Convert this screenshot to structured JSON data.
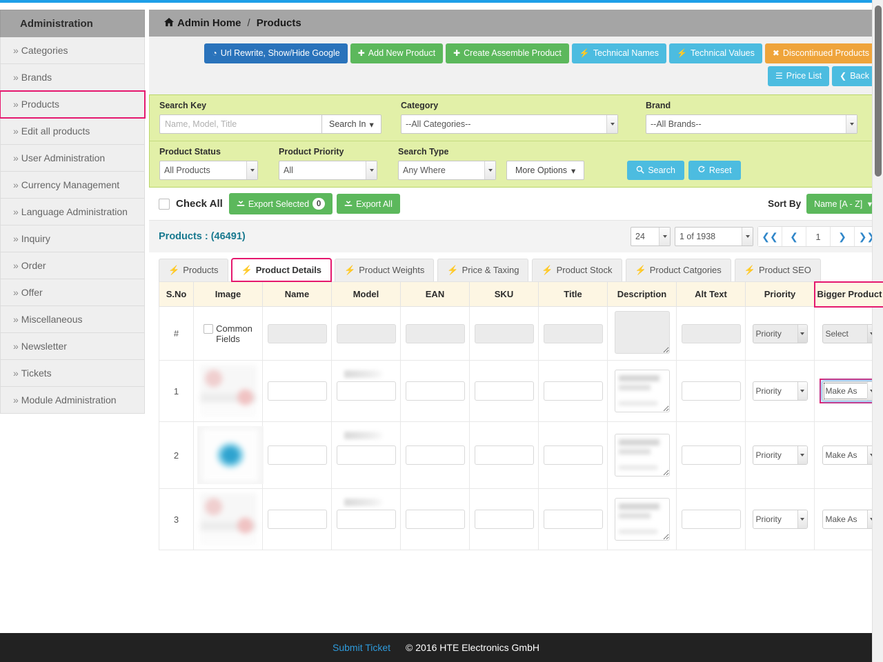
{
  "sidebar": {
    "header": "Administration",
    "chevron": "»",
    "items": [
      {
        "label": "Categories",
        "active": false
      },
      {
        "label": "Brands",
        "active": false
      },
      {
        "label": "Products",
        "active": true
      },
      {
        "label": "Edit all products",
        "active": false
      },
      {
        "label": "User Administration",
        "active": false
      },
      {
        "label": "Currency Management",
        "active": false
      },
      {
        "label": "Language Administration",
        "active": false
      },
      {
        "label": "Inquiry",
        "active": false
      },
      {
        "label": "Order",
        "active": false
      },
      {
        "label": "Offer",
        "active": false
      },
      {
        "label": "Miscellaneous",
        "active": false
      },
      {
        "label": "Newsletter",
        "active": false
      },
      {
        "label": "Tickets",
        "active": false
      },
      {
        "label": "Module Administration",
        "active": false
      }
    ]
  },
  "breadcrumb": {
    "home": "Admin Home",
    "separator": "/",
    "current": "Products",
    "home_icon": "home-icon"
  },
  "toolbar": {
    "row1": [
      {
        "label": "Url Rewrite, Show/Hide Google",
        "icon": "globe-icon",
        "glyph": "◔",
        "color": "#2a73bb",
        "style": "b-blue"
      },
      {
        "label": "Add New Product",
        "icon": "plus-icon",
        "glyph": "✚",
        "color": "#5cb85c",
        "style": "b-green"
      },
      {
        "label": "Create Assemble Product",
        "icon": "plus-icon",
        "glyph": "✚",
        "color": "#5cb85c",
        "style": "b-green"
      },
      {
        "label": "Technical Names",
        "icon": "bolt-icon",
        "glyph": "⚡",
        "color": "#4cbce0",
        "style": "b-cyan"
      },
      {
        "label": "Technical Values",
        "icon": "bolt-icon",
        "glyph": "⚡",
        "color": "#4cbce0",
        "style": "b-cyan"
      },
      {
        "label": "Discontinued Products",
        "icon": "cross-icon",
        "glyph": "✖",
        "color": "#efa43b",
        "style": "b-orange"
      }
    ],
    "row2": [
      {
        "label": "Price List",
        "icon": "list-icon",
        "glyph": "☰",
        "color": "#4cbce0",
        "style": "b-cyan"
      },
      {
        "label": "Back",
        "icon": "chevron-left-icon",
        "glyph": "❮",
        "color": "#4cbce0",
        "style": "b-cyan"
      }
    ]
  },
  "search": {
    "search_key_label": "Search Key",
    "search_key_placeholder": "Name, Model, Title",
    "search_key_value": "",
    "search_in_label": "Search In",
    "category_label": "Category",
    "category_value": "--All Categories--",
    "brand_label": "Brand",
    "brand_value": "--All Brands--",
    "product_status_label": "Product Status",
    "product_status_value": "All Products",
    "product_priority_label": "Product Priority",
    "product_priority_value": "All",
    "search_type_label": "Search Type",
    "search_type_value": "Any Where",
    "more_options_label": "More Options",
    "search_button": "Search",
    "reset_button": "Reset",
    "search_icon": "magnifier-icon",
    "reset_icon": "refresh-icon",
    "caret": "▾"
  },
  "export_bar": {
    "check_all_label": "Check All",
    "export_selected_label": "Export Selected",
    "export_selected_count": "0",
    "export_all_label": "Export All",
    "sort_by_label": "Sort By",
    "sort_value": "Name [A - Z]",
    "sort_caret": "▾",
    "export_icon": "export-icon"
  },
  "listing": {
    "count_label": "Products : (46491)",
    "per_page": "24",
    "page_of": "1 of 1938",
    "current_page": "1",
    "first_icon": "❮❮",
    "prev_icon": "❮",
    "next_icon": "❯",
    "last_icon": "❯❯"
  },
  "tabs": [
    {
      "label": "Products",
      "active": false
    },
    {
      "label": "Product Details",
      "active": true
    },
    {
      "label": "Product Weights",
      "active": false
    },
    {
      "label": "Price & Taxing",
      "active": false
    },
    {
      "label": "Product Stock",
      "active": false
    },
    {
      "label": "Product Catgories",
      "active": false
    },
    {
      "label": "Product SEO",
      "active": false
    }
  ],
  "table": {
    "columns": [
      {
        "label": "S.No",
        "highlight": false
      },
      {
        "label": "Image",
        "highlight": false
      },
      {
        "label": "Name",
        "highlight": false
      },
      {
        "label": "Model",
        "highlight": false
      },
      {
        "label": "EAN",
        "highlight": false
      },
      {
        "label": "SKU",
        "highlight": false
      },
      {
        "label": "Title",
        "highlight": false
      },
      {
        "label": "Description",
        "highlight": false
      },
      {
        "label": "Alt Text",
        "highlight": false
      },
      {
        "label": "Priority",
        "highlight": false
      },
      {
        "label": "Bigger Product",
        "highlight": true
      }
    ],
    "common_row": {
      "sno": "#",
      "common_fields_label": "Common Fields",
      "priority_value": "Priority",
      "bigger_product_value": "Select"
    },
    "rows": [
      {
        "sno": "1",
        "priority_value": "Priority",
        "bigger_product_value": "Make As",
        "bigger_focused": true,
        "image_style": "img-a"
      },
      {
        "sno": "2",
        "priority_value": "Priority",
        "bigger_product_value": "Make As",
        "bigger_focused": false,
        "image_style": "img-b"
      },
      {
        "sno": "3",
        "priority_value": "Priority",
        "bigger_product_value": "Make As",
        "bigger_focused": false,
        "image_style": "img-a"
      }
    ]
  },
  "footer": {
    "submit_ticket": "Submit Ticket",
    "copyright": "© 2016 HTE Electronics GmbH"
  },
  "colors": {
    "accent_blue": "#1e9fe8",
    "highlight_pink": "#e5186e",
    "panel_green": "#e2f0a8",
    "header_cream": "#fdf6e3",
    "green_button": "#5cb85c",
    "cyan_button": "#4cbce0",
    "orange_button": "#efa43b",
    "blue_button": "#2a73bb",
    "teal_text": "#18798f"
  }
}
